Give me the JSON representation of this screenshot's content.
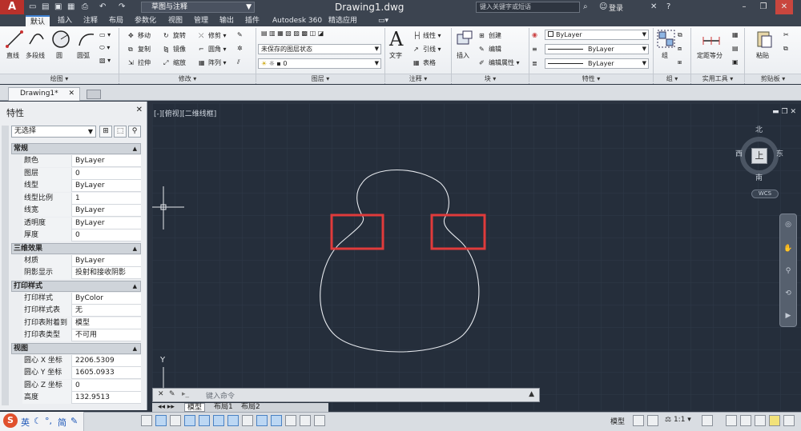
{
  "app": {
    "logo": "A",
    "title": "Drawing1.dwg"
  },
  "workspace": "草图与注释",
  "search_placeholder": "键入关键字或短语",
  "login": "登录",
  "ribbon_tabs": [
    "默认",
    "插入",
    "注释",
    "布局",
    "参数化",
    "视图",
    "管理",
    "输出",
    "插件",
    "Autodesk 360",
    "精选应用"
  ],
  "panels": {
    "draw": {
      "label": "绘图",
      "line": "直线",
      "polyline": "多段线",
      "circle": "圆",
      "arc": "圆弧"
    },
    "modify": {
      "label": "修改",
      "move": "移动",
      "rotate": "旋转",
      "trim": "修剪",
      "copy": "复制",
      "mirror": "镜像",
      "fillet": "圆角",
      "stretch": "拉伸",
      "scale": "缩放",
      "array": "阵列"
    },
    "layers": {
      "label": "图层",
      "layer_state": "未保存的图层状态",
      "current_layer": "0"
    },
    "annotation": {
      "label": "注释",
      "text": "文字",
      "linear": "线性",
      "leader": "引线",
      "table": "表格"
    },
    "block": {
      "label": "块",
      "insert": "插入",
      "create": "创建",
      "edit": "编辑",
      "edit_attr": "编辑属性"
    },
    "properties": {
      "label": "特性",
      "color": "ByLayer",
      "linetype": "ByLayer",
      "lineweight": "ByLayer"
    },
    "group": {
      "label": "组",
      "group": "组"
    },
    "utilities": {
      "label": "实用工具",
      "measure": "定距等分"
    },
    "clipboard": {
      "label": "剪贴板",
      "paste": "粘贴"
    }
  },
  "doc_tab": "Drawing1*",
  "properties_palette": {
    "title": "特性",
    "selection": "无选择",
    "sections": [
      {
        "title": "常规",
        "rows": [
          [
            "颜色",
            "ByLayer"
          ],
          [
            "图层",
            "0"
          ],
          [
            "线型",
            "ByLayer"
          ],
          [
            "线型比例",
            "1"
          ],
          [
            "线宽",
            "ByLayer"
          ],
          [
            "透明度",
            "ByLayer"
          ],
          [
            "厚度",
            "0"
          ]
        ]
      },
      {
        "title": "三维效果",
        "rows": [
          [
            "材质",
            "ByLayer"
          ],
          [
            "阴影显示",
            "投射和接收阴影"
          ]
        ]
      },
      {
        "title": "打印样式",
        "rows": [
          [
            "打印样式",
            "ByColor"
          ],
          [
            "打印样式表",
            "无"
          ],
          [
            "打印表附着到",
            "模型"
          ],
          [
            "打印表类型",
            "不可用"
          ]
        ]
      },
      {
        "title": "视图",
        "rows": [
          [
            "圆心 X 坐标",
            "2206.5309"
          ],
          [
            "圆心 Y 坐标",
            "1605.0933"
          ],
          [
            "圆心 Z 坐标",
            "0"
          ],
          [
            "高度",
            "132.9513"
          ]
        ]
      }
    ]
  },
  "viewport": {
    "label": "[-][俯视][二维线框]",
    "viewcube": {
      "top_face": "上",
      "north": "北",
      "south": "南",
      "west": "西",
      "east": "东",
      "wcs": "WCS"
    },
    "ucs_y": "Y"
  },
  "command_placeholder": "键入命令",
  "layout_tabs": [
    "模型",
    "布局1",
    "布局2"
  ],
  "status": {
    "model": "模型",
    "scale": "1:1"
  },
  "ime": {
    "brand": "S",
    "lang": "英",
    "mode": "简"
  }
}
